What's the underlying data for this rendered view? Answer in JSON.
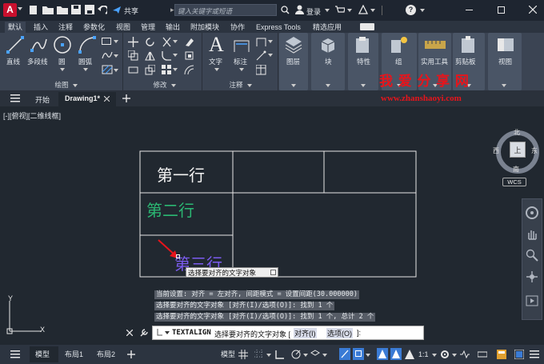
{
  "app": {
    "logo_letter": "A",
    "share_label": "共享",
    "search_placeholder": "键入关键字或短语",
    "login_label": "登录",
    "help_label": "?"
  },
  "ribbon_tabs": [
    "默认",
    "插入",
    "注释",
    "参数化",
    "视图",
    "管理",
    "输出",
    "附加模块",
    "协作",
    "Express Tools",
    "精选应用"
  ],
  "ribbon": {
    "draw": {
      "line": "直线",
      "polyline": "多段线",
      "circle": "圆",
      "arc": "圆弧",
      "panel": "绘图"
    },
    "modify": {
      "panel": "修改"
    },
    "annotation": {
      "text": "文字",
      "dimension": "标注",
      "panel": "注释"
    },
    "layers": {
      "label": "图层"
    },
    "block": {
      "label": "块"
    },
    "properties": {
      "label": "特性"
    },
    "group": {
      "label": "组"
    },
    "utilities": {
      "label": "实用工具"
    },
    "clipboard": {
      "label": "剪贴板"
    },
    "view": {
      "label": "视图"
    }
  },
  "watermark": {
    "title": "我 爱 分 享 网",
    "url": "www.zhanshaoyi.com"
  },
  "doc_tabs": {
    "start": "开始",
    "drawing": "Drawing1*"
  },
  "viewport": {
    "label": "[-][俯视][二维线框]"
  },
  "viewcube": {
    "north": "北",
    "south": "南",
    "east": "东",
    "west": "西",
    "top": "上",
    "wcs": "WCS"
  },
  "table": {
    "row1": "第一行",
    "row2": "第二行",
    "row3": "第三行",
    "row2_color": "#2bb873",
    "row3_color": "#7c5cf0"
  },
  "tooltip": "选择要对齐的文字对象",
  "command_history": [
    "当前设置: 对齐 = 左对齐, 间距模式 = 设置间距(30.000000)",
    "选择要对齐的文字对象 [对齐(I)/选项(O)]: 找到 1 个",
    "选择要对齐的文字对象 [对齐(I)/选项(O)]: 找到 1 个, 总计 2 个"
  ],
  "command_input": {
    "command": "TEXTALIGN",
    "prompt": "选择要对齐的文字对象 [",
    "opt1": "对齐(I)",
    "opt2": "选项(O)",
    "suffix": "]:"
  },
  "ucs": {
    "x": "X",
    "y": "Y"
  },
  "status_tabs": {
    "model": "模型",
    "layout1": "布局1",
    "layout2": "布局2"
  },
  "status_right": {
    "model": "模型",
    "scale": "1:1"
  },
  "colors": {
    "accent": "#c8102e",
    "table_lines": "#e6e6e6",
    "active_toggle": "#3a7bd5"
  }
}
